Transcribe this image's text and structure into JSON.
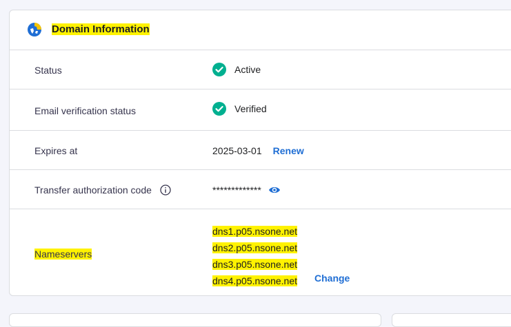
{
  "header": {
    "title": "Domain Information",
    "icon": "globe-icon"
  },
  "rows": {
    "status": {
      "label": "Status",
      "value": "Active",
      "icon": "check-circle-icon"
    },
    "email_verification": {
      "label": "Email verification status",
      "value": "Verified",
      "icon": "check-circle-icon"
    },
    "expires": {
      "label": "Expires at",
      "value": "2025-03-01",
      "action": "Renew"
    },
    "transfer": {
      "label": "Transfer authorization code",
      "value": "*************",
      "icon": "info-icon",
      "action_icon": "eye-icon"
    },
    "nameservers": {
      "label": "Nameservers",
      "items": [
        "dns1.p05.nsone.net",
        "dns2.p05.nsone.net",
        "dns3.p05.nsone.net",
        "dns4.p05.nsone.net"
      ],
      "action": "Change"
    }
  },
  "colors": {
    "accent": "#1f6ed4",
    "success": "#00b090",
    "highlight": "#fff200",
    "border": "#dadce0",
    "background": "#f4f5fb"
  }
}
